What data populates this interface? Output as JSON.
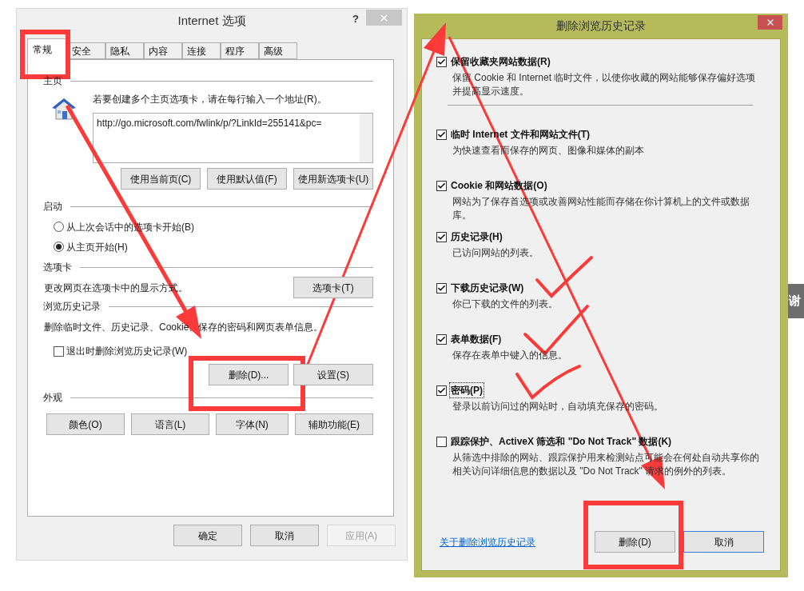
{
  "internet_options_dialog": {
    "title": "Internet 选项",
    "help": "?",
    "tabs": [
      {
        "label": "常规",
        "selected": true
      },
      {
        "label": "安全",
        "selected": false
      },
      {
        "label": "隐私",
        "selected": false
      },
      {
        "label": "内容",
        "selected": false
      },
      {
        "label": "连接",
        "selected": false
      },
      {
        "label": "程序",
        "selected": false
      },
      {
        "label": "高级",
        "selected": false
      }
    ],
    "home_page": {
      "heading": "主页",
      "instruction": "若要创建多个主页选项卡，请在每行输入一个地址(R)。",
      "url": "http://go.microsoft.com/fwlink/p/?LinkId=255141&pc=",
      "buttons": [
        "使用当前页(C)",
        "使用默认值(F)",
        "使用新选项卡(U)"
      ]
    },
    "startup": {
      "heading": "启动",
      "options": [
        {
          "label": "从上次会话中的选项卡开始(B)",
          "selected": false
        },
        {
          "label": "从主页开始(H)",
          "selected": true
        }
      ]
    },
    "tabs_section": {
      "heading": "选项卡",
      "description": "更改网页在选项卡中的显示方式。",
      "button": "选项卡(T)"
    },
    "history": {
      "heading": "浏览历史记录",
      "description": "删除临时文件、历史记录、Cookie、保存的密码和网页表单信息。",
      "delete_on_exit": {
        "label": "退出时删除浏览历史记录(W)",
        "checked": false
      },
      "buttons": [
        "删除(D)...",
        "设置(S)"
      ]
    },
    "appearance": {
      "heading": "外观",
      "buttons": [
        "颜色(O)",
        "语言(L)",
        "字体(N)",
        "辅助功能(E)"
      ]
    },
    "footer_buttons": [
      {
        "label": "确定",
        "disabled": false
      },
      {
        "label": "取消",
        "disabled": false
      },
      {
        "label": "应用(A)",
        "disabled": true
      }
    ]
  },
  "delete_history_dialog": {
    "title": "删除浏览历史记录",
    "items": [
      {
        "label": "保留收藏夹网站数据(R)",
        "description": "保留 Cookie 和 Internet 临时文件，以使你收藏的网站能够保存偏好选项并提高显示速度。",
        "checked": true,
        "focused": false
      },
      {
        "label": "临时 Internet 文件和网站文件(T)",
        "description": "为快速查看而保存的网页、图像和媒体的副本",
        "checked": true,
        "focused": false
      },
      {
        "label": "Cookie 和网站数据(O)",
        "description": "网站为了保存首选项或改善网站性能而存储在你计算机上的文件或数据库。",
        "checked": true,
        "focused": false
      },
      {
        "label": "历史记录(H)",
        "description": "已访问网站的列表。",
        "checked": true,
        "focused": false
      },
      {
        "label": "下载历史记录(W)",
        "description": "你已下载的文件的列表。",
        "checked": true,
        "focused": false
      },
      {
        "label": "表单数据(F)",
        "description": "保存在表单中键入的信息。",
        "checked": true,
        "focused": false
      },
      {
        "label": "密码(P)",
        "description": "登录以前访问过的网站时，自动填充保存的密码。",
        "checked": true,
        "focused": true
      },
      {
        "label": "跟踪保护、ActiveX 筛选和 \"Do Not Track\" 数据(K)",
        "description": "从筛选中排除的网站、跟踪保护用来检测站点可能会在何处自动共享你的相关访问详细信息的数据以及 \"Do Not Track\" 请求的例外的列表。",
        "checked": false,
        "focused": false
      }
    ],
    "link": "关于删除浏览历史记录",
    "buttons": [
      {
        "label": "删除(D)",
        "default": false
      },
      {
        "label": "取消",
        "default": true
      }
    ]
  },
  "side_button": {
    "label": "谢"
  }
}
